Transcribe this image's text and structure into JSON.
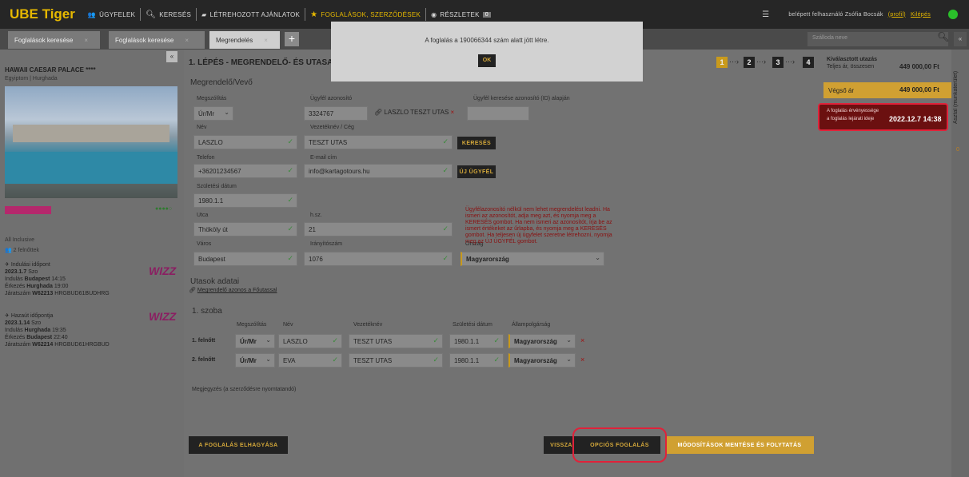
{
  "topnav": {
    "logo": "UBE Tiger",
    "items": [
      "ÜGYFELEK",
      "KERESÉS",
      "LÉTREHOZOTT AJÁNLATOK",
      "FOGLALÁSOK, SZERZŐDÉSEK",
      "RÉSZLETEK"
    ],
    "badge": "0",
    "user_prefix": "belépett felhasználó Zsófia Bocsák",
    "profile_link": "(profil)",
    "logout_link": "Kilépés"
  },
  "tabs": [
    "Foglalások keresése",
    "Foglalások keresése",
    "Megrendelés"
  ],
  "search": {
    "placeholder": "Szálloda neve"
  },
  "hotel": {
    "name": "HAWAII CAESAR PALACE ****",
    "location": "Egyiptom | Hurghada",
    "rating": "●●●●○",
    "board": "All Inclusive",
    "pax": "2 felnőttek"
  },
  "outbound": {
    "title": "Indulási időpont",
    "date": "2023.1.7",
    "day": "Szo",
    "dep_prefix": "Indulás",
    "dep_city": "Budapest",
    "dep_time": "14:15",
    "arr_prefix": "Érkezés",
    "arr_city": "Hurghada",
    "arr_time": "19:00",
    "flight_prefix": "Járatszám",
    "flight_no": "W62213",
    "route": "HRGBUD61BUDHRG",
    "airline": "WIZZ"
  },
  "inbound": {
    "title": "Hazaút időpontja",
    "date": "2023.1.14",
    "day": "Szo",
    "dep_prefix": "Indulás",
    "dep_city": "Hurghada",
    "dep_time": "19:35",
    "arr_prefix": "Érkezés",
    "arr_city": "Budapest",
    "arr_time": "22:40",
    "flight_prefix": "Járatszám",
    "flight_no": "W62214",
    "route": "HRGBUD61HRGBUD",
    "airline": "WIZZ"
  },
  "step": {
    "num": "1. LÉPÉS",
    "dash": " - ",
    "title": "MEGRENDELŐ- ÉS UTASA",
    "steps": [
      "1",
      "2",
      "3",
      "4"
    ],
    "arrow": "···›"
  },
  "orderer": {
    "section": "Megrendelő/Vevő",
    "salutation_label": "Megszólítás",
    "salutation": "Úr/Mr",
    "client_id_label": "Ügyfél azonosító",
    "client_id": "3324767",
    "linked_client": "LASZLO TESZT UTAS",
    "search_by_id_label": "Ügyfél keresése azonosító (ID) alapján",
    "name_label": "Név",
    "name": "LASZLO",
    "surname_label": "Vezetéknév / Cég",
    "surname": "TESZT UTAS",
    "search_button": "KERESÉS",
    "phone_label": "Telefon",
    "phone": "+36201234567",
    "email_label": "E-mail cím",
    "email": "info@kartagotours.hu",
    "new_client_button": "ÚJ ÜGYFÉL",
    "birth_label": "Születési dátum",
    "birth": "1980.1.1",
    "street_label": "Utca",
    "street": "Thököly út",
    "house_label": "h.sz.",
    "house": "21",
    "city_label": "Város",
    "city": "Budapest",
    "zip_label": "Irányítószám",
    "zip": "1076",
    "country_label": "Ország",
    "country": "Magyarország",
    "warning": "Ügyfélazonosító nélkül nem lehet megrendelést leadni. Ha ismeri az azonosítót, adja meg azt, és nyomja meg a KERESÉS gombot. Ha nem ismeri az azonosítót, írja be az ismert értékeket az űrlapba, és nyomja meg a KERESÉS gombot. Ha teljesen új ügyfelet szeretne létrehozni, nyomja meg az ÚJ ÜGYFÉL gombot."
  },
  "travelers": {
    "section": "Utasok adatai",
    "same_as_orderer": "Megrendelő azonos a Főutassal",
    "room": "1. szoba",
    "headers": [
      "Megszólítás",
      "Név",
      "Vezetéknév",
      "Születési dátum",
      "Állampolgárság"
    ],
    "rows": [
      {
        "label": "1. felnőtt",
        "salutation": "Úr/Mr",
        "name": "LASZLO",
        "surname": "TESZT UTAS",
        "birth": "1980.1.1",
        "nationality": "Magyarország"
      },
      {
        "label": "2. felnőtt",
        "salutation": "Úr/Mr",
        "name": "EVA",
        "surname": "TESZT UTAS",
        "birth": "1980.1.1",
        "nationality": "Magyarország"
      }
    ]
  },
  "note_label": "Megjegyzés (a szerződésre nyomtatandó)",
  "buttons": {
    "abandon": "A FOGLALÁS ELHAGYÁSA",
    "back": "VISSZA",
    "option": "OPCIÓS FOGLALÁS",
    "save_continue": "MÓDOSÍTÁSOK MENTÉSE ÉS FOLYTATÁS"
  },
  "summary": {
    "chosen_title": "Kiválasztott utazás",
    "total_label": "Teljes ár, összesen",
    "total_value": "449 000,00 Ft",
    "final_label": "Végső ár",
    "final_value": "449 000,00 Ft",
    "valid_title": "A foglalás érvényessége",
    "valid_sub": "a foglalás lejárati ideje",
    "valid_date": "2022.12.7 14:38"
  },
  "right_sidebar": {
    "label": "Asztal (munkaterület)",
    "badge": "0"
  },
  "modal": {
    "message": "A foglalás a 190066344 szám alatt jött létre.",
    "ok": "OK"
  }
}
